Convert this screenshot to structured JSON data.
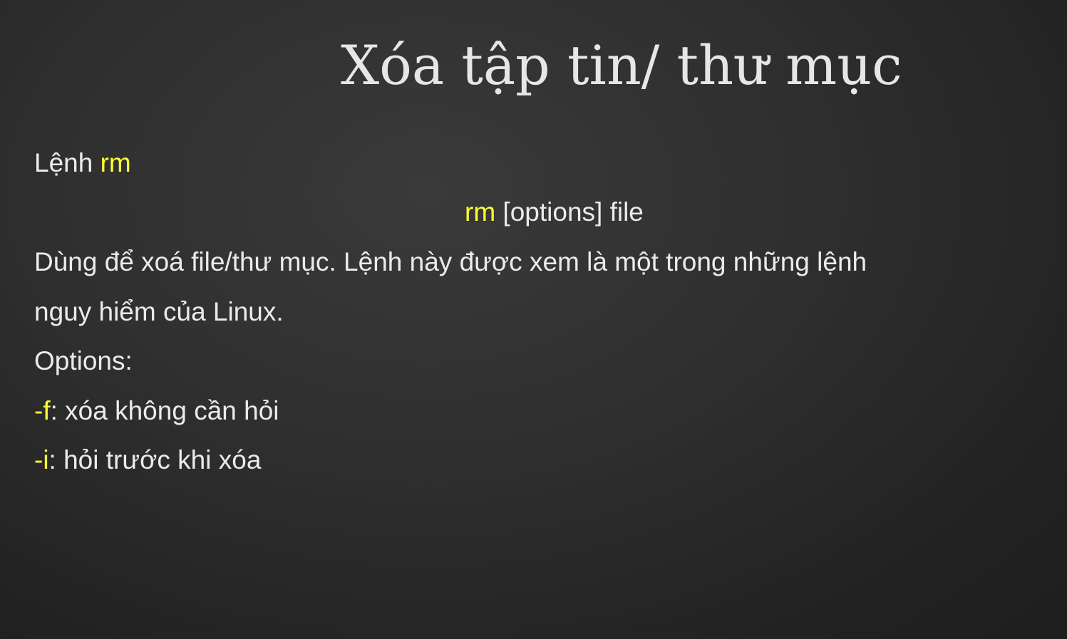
{
  "slide": {
    "title": "Xóa tập tin/ thư mục",
    "command_heading": {
      "prefix": "Lệnh ",
      "command": "rm"
    },
    "syntax": {
      "command": "rm",
      "rest": " [options] file"
    },
    "description_line1": "Dùng để xoá file/thư mục. Lệnh này được xem là một trong những lệnh",
    "description_line2": "nguy hiểm của Linux.",
    "options_label": "Options:",
    "options": [
      {
        "flag": "-f",
        "text": ": xóa không cần hỏi"
      },
      {
        "flag": "-i",
        "text": ": hỏi trước khi xóa"
      }
    ]
  },
  "colors": {
    "background": "#2e2e2e",
    "text": "#ebebeb",
    "highlight": "#ffff33"
  }
}
